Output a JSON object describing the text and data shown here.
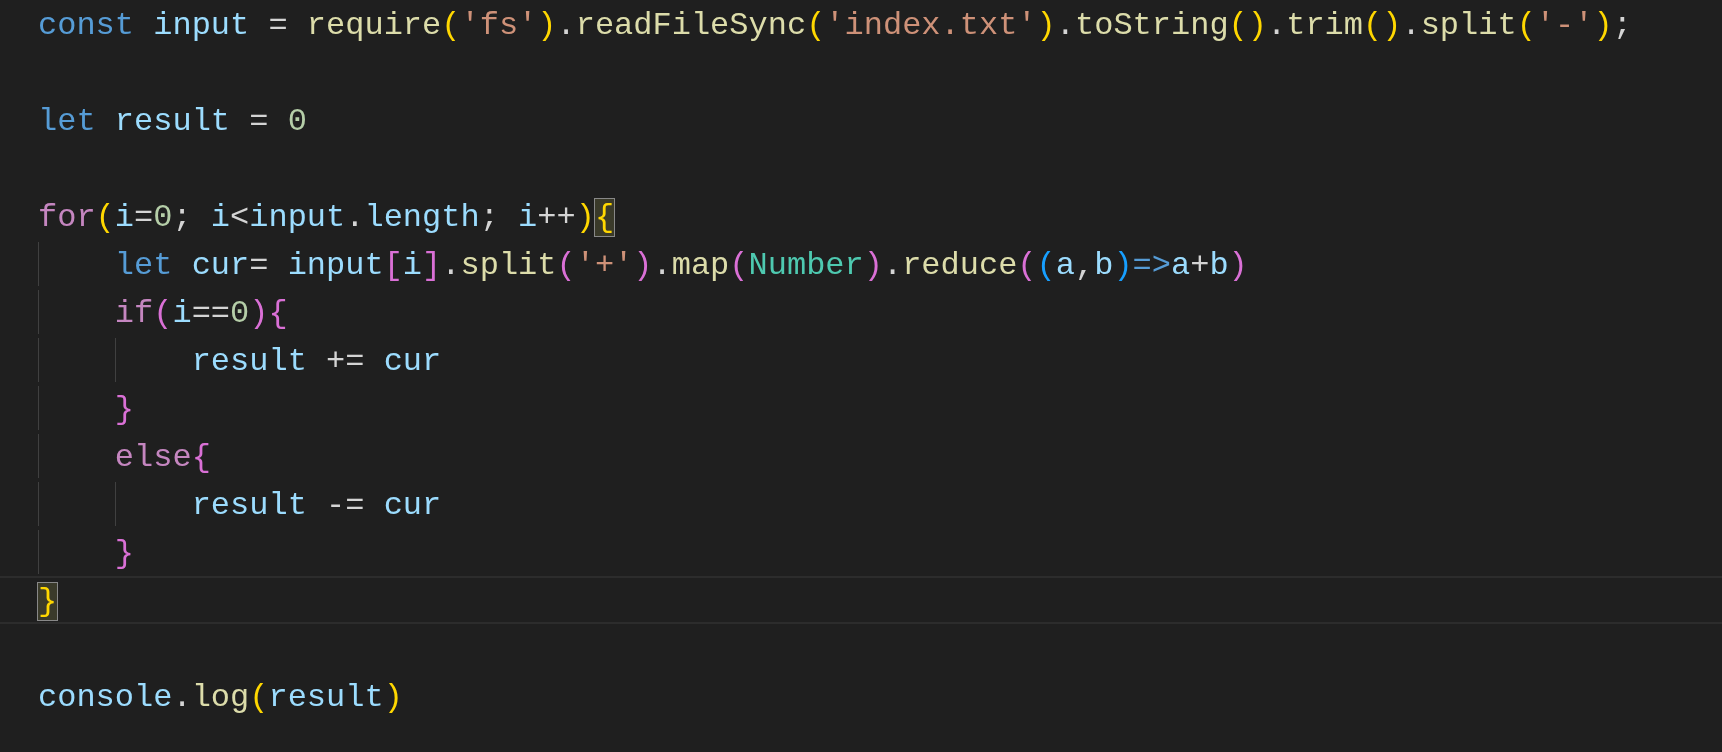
{
  "editor": {
    "lines": [
      {
        "selected": false,
        "tokens": [
          {
            "text": "const ",
            "kind": "keyword"
          },
          {
            "text": "input",
            "kind": "variable"
          },
          {
            "text": " = ",
            "kind": "plain"
          },
          {
            "text": "require",
            "kind": "function"
          },
          {
            "text": "(",
            "kind": "bracket1"
          },
          {
            "text": "'fs'",
            "kind": "string"
          },
          {
            "text": ")",
            "kind": "bracket1"
          },
          {
            "text": ".",
            "kind": "plain"
          },
          {
            "text": "readFileSync",
            "kind": "function"
          },
          {
            "text": "(",
            "kind": "bracket1"
          },
          {
            "text": "'index.txt'",
            "kind": "string"
          },
          {
            "text": ")",
            "kind": "bracket1"
          },
          {
            "text": ".",
            "kind": "plain"
          },
          {
            "text": "toString",
            "kind": "function"
          },
          {
            "text": "()",
            "kind": "bracket1"
          },
          {
            "text": ".",
            "kind": "plain"
          },
          {
            "text": "trim",
            "kind": "function"
          },
          {
            "text": "()",
            "kind": "bracket1"
          },
          {
            "text": ".",
            "kind": "plain"
          },
          {
            "text": "split",
            "kind": "function"
          },
          {
            "text": "(",
            "kind": "bracket1"
          },
          {
            "text": "'-'",
            "kind": "string"
          },
          {
            "text": ")",
            "kind": "bracket1"
          },
          {
            "text": ";",
            "kind": "plain"
          }
        ]
      },
      {
        "selected": false
      },
      {
        "selected": false,
        "tokens": [
          {
            "text": "let ",
            "kind": "keyword"
          },
          {
            "text": "result",
            "kind": "variable"
          },
          {
            "text": " = ",
            "kind": "plain"
          },
          {
            "text": "0",
            "kind": "number"
          }
        ]
      },
      {
        "selected": false
      },
      {
        "selected": false,
        "tokens": [
          {
            "text": "for",
            "kind": "control"
          },
          {
            "text": "(",
            "kind": "bracket1"
          },
          {
            "text": "i",
            "kind": "variable"
          },
          {
            "text": "=",
            "kind": "plain"
          },
          {
            "text": "0",
            "kind": "number"
          },
          {
            "text": "; ",
            "kind": "plain"
          },
          {
            "text": "i",
            "kind": "variable"
          },
          {
            "text": "<",
            "kind": "plain"
          },
          {
            "text": "input",
            "kind": "variable"
          },
          {
            "text": ".",
            "kind": "plain"
          },
          {
            "text": "length",
            "kind": "variable"
          },
          {
            "text": "; ",
            "kind": "plain"
          },
          {
            "text": "i",
            "kind": "variable"
          },
          {
            "text": "++",
            "kind": "plain"
          },
          {
            "text": ")",
            "kind": "bracket1"
          },
          {
            "text": "{",
            "kind": "bracket1",
            "matched": true
          }
        ],
        "children": [
          {
            "selected": false,
            "tokens": [
              {
                "text": "let ",
                "kind": "keyword"
              },
              {
                "text": "cur",
                "kind": "variable"
              },
              {
                "text": "= ",
                "kind": "plain"
              },
              {
                "text": "input",
                "kind": "variable"
              },
              {
                "text": "[",
                "kind": "bracket2"
              },
              {
                "text": "i",
                "kind": "variable"
              },
              {
                "text": "]",
                "kind": "bracket2"
              },
              {
                "text": ".",
                "kind": "plain"
              },
              {
                "text": "split",
                "kind": "function"
              },
              {
                "text": "(",
                "kind": "bracket2"
              },
              {
                "text": "'+'",
                "kind": "string"
              },
              {
                "text": ")",
                "kind": "bracket2"
              },
              {
                "text": ".",
                "kind": "plain"
              },
              {
                "text": "map",
                "kind": "function"
              },
              {
                "text": "(",
                "kind": "bracket2"
              },
              {
                "text": "Number",
                "kind": "class"
              },
              {
                "text": ")",
                "kind": "bracket2"
              },
              {
                "text": ".",
                "kind": "plain"
              },
              {
                "text": "reduce",
                "kind": "function"
              },
              {
                "text": "(",
                "kind": "bracket2"
              },
              {
                "text": "(",
                "kind": "bracket3"
              },
              {
                "text": "a",
                "kind": "variable"
              },
              {
                "text": ",",
                "kind": "plain"
              },
              {
                "text": "b",
                "kind": "variable"
              },
              {
                "text": ")",
                "kind": "bracket3"
              },
              {
                "text": "=>",
                "kind": "keyword"
              },
              {
                "text": "a",
                "kind": "variable"
              },
              {
                "text": "+",
                "kind": "plain"
              },
              {
                "text": "b",
                "kind": "variable"
              },
              {
                "text": ")",
                "kind": "bracket2"
              }
            ]
          },
          {
            "selected": false,
            "tokens": [
              {
                "text": "if",
                "kind": "control"
              },
              {
                "text": "(",
                "kind": "bracket2"
              },
              {
                "text": "i",
                "kind": "variable"
              },
              {
                "text": "==",
                "kind": "plain"
              },
              {
                "text": "0",
                "kind": "number"
              },
              {
                "text": ")",
                "kind": "bracket2"
              },
              {
                "text": "{",
                "kind": "bracket2"
              }
            ],
            "children": [
              {
                "selected": false,
                "tokens": [
                  {
                    "text": "result",
                    "kind": "variable"
                  },
                  {
                    "text": " += ",
                    "kind": "plain"
                  },
                  {
                    "text": "cur",
                    "kind": "variable"
                  }
                ]
              }
            ]
          },
          {
            "selected": false,
            "tokens": [
              {
                "text": "}",
                "kind": "bracket2"
              }
            ]
          },
          {
            "selected": false,
            "tokens": [
              {
                "text": "else",
                "kind": "control"
              },
              {
                "text": "{",
                "kind": "bracket2"
              }
            ],
            "children": [
              {
                "selected": false,
                "tokens": [
                  {
                    "text": "result",
                    "kind": "variable"
                  },
                  {
                    "text": " -= ",
                    "kind": "plain"
                  },
                  {
                    "text": "cur",
                    "kind": "variable"
                  }
                ]
              }
            ]
          },
          {
            "selected": false,
            "tokens": [
              {
                "text": "}",
                "kind": "bracket2"
              }
            ]
          }
        ]
      },
      {
        "selected": true,
        "tokens": [
          {
            "text": "}",
            "kind": "bracket1",
            "matched": true
          }
        ]
      },
      {
        "selected": false
      },
      {
        "selected": false,
        "tokens": [
          {
            "text": "console",
            "kind": "variable"
          },
          {
            "text": ".",
            "kind": "plain"
          },
          {
            "text": "log",
            "kind": "function"
          },
          {
            "text": "(",
            "kind": "bracket1"
          },
          {
            "text": "result",
            "kind": "variable"
          },
          {
            "text": ")",
            "kind": "bracket1"
          }
        ]
      }
    ]
  }
}
